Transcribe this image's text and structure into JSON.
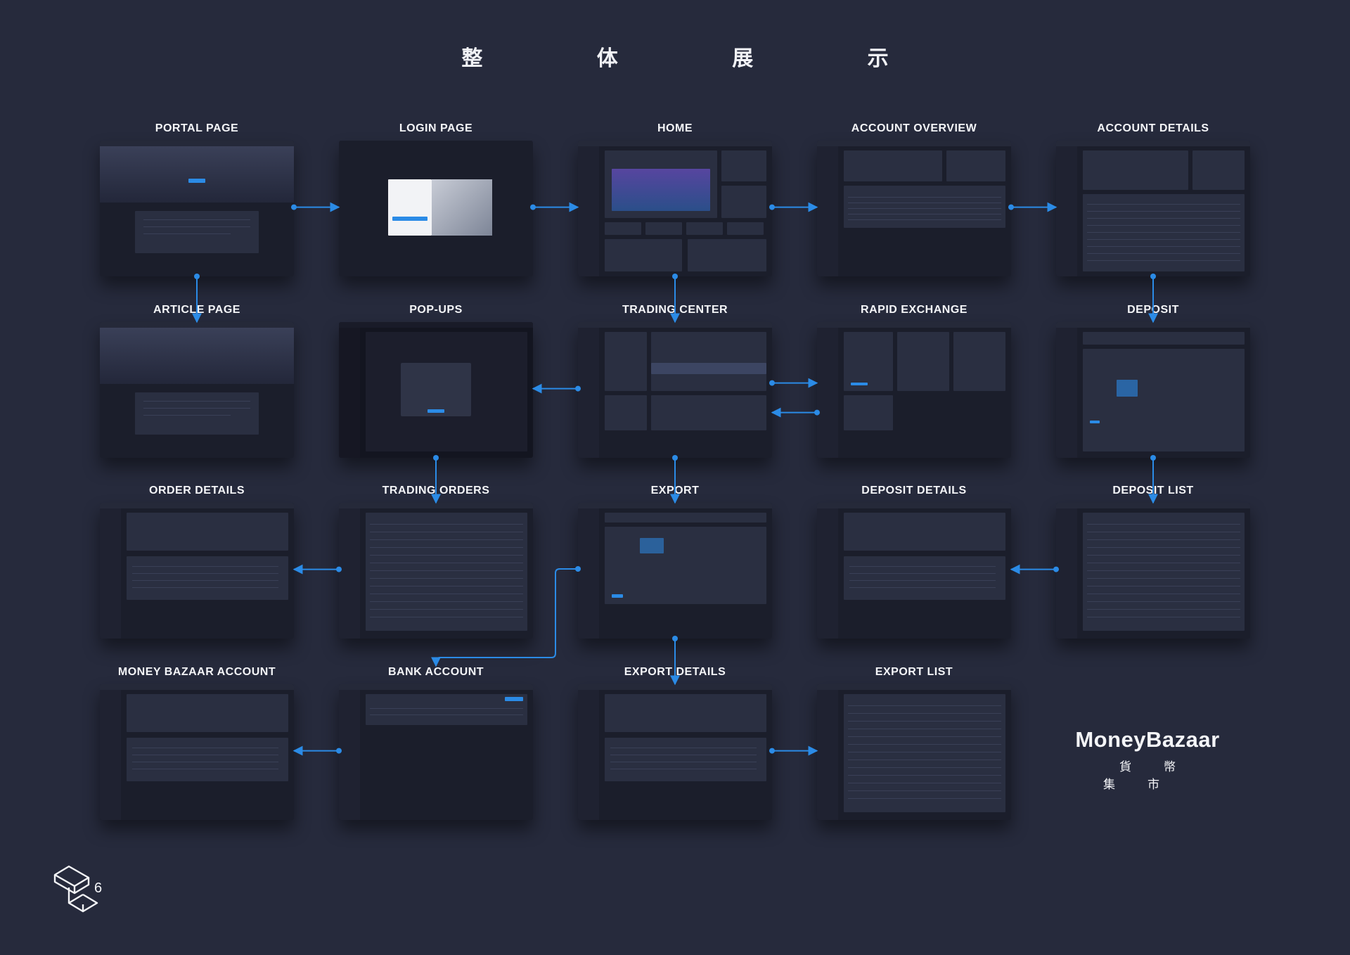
{
  "title": "整 体 展 示",
  "screens": [
    {
      "id": "portal-page",
      "label": "PORTAL PAGE",
      "kind": "portal"
    },
    {
      "id": "login-page",
      "label": "LOGIN PAGE",
      "kind": "login"
    },
    {
      "id": "home",
      "label": "HOME",
      "kind": "home"
    },
    {
      "id": "account-overview",
      "label": "ACCOUNT OVERVIEW",
      "kind": "overview"
    },
    {
      "id": "account-details",
      "label": "ACCOUNT DETAILS",
      "kind": "details"
    },
    {
      "id": "article-page",
      "label": "ARTICLE PAGE",
      "kind": "article"
    },
    {
      "id": "pop-ups",
      "label": "POP-UPS",
      "kind": "popup"
    },
    {
      "id": "trading-center",
      "label": "TRADING CENTER",
      "kind": "trading"
    },
    {
      "id": "rapid-exchange",
      "label": "RAPID EXCHANGE",
      "kind": "exchange"
    },
    {
      "id": "deposit",
      "label": "DEPOSIT",
      "kind": "deposit"
    },
    {
      "id": "order-details",
      "label": "ORDER DETAILS",
      "kind": "split"
    },
    {
      "id": "trading-orders",
      "label": "TRADING ORDERS",
      "kind": "table"
    },
    {
      "id": "export",
      "label": "EXPORT",
      "kind": "form"
    },
    {
      "id": "deposit-details",
      "label": "DEPOSIT DETAILS",
      "kind": "split"
    },
    {
      "id": "deposit-list",
      "label": "DEPOSIT LIST",
      "kind": "table"
    },
    {
      "id": "money-bazaar-account",
      "label": "MONEY BAZAAR ACCOUNT",
      "kind": "split"
    },
    {
      "id": "bank-account",
      "label": "BANK ACCOUNT",
      "kind": "bank"
    },
    {
      "id": "export-details",
      "label": "EXPORT DETAILS",
      "kind": "split"
    },
    {
      "id": "export-list",
      "label": "EXPORT LIST",
      "kind": "table"
    }
  ],
  "connections": [
    [
      "portal-page",
      "login-page"
    ],
    [
      "login-page",
      "home"
    ],
    [
      "home",
      "account-overview"
    ],
    [
      "account-overview",
      "account-details"
    ],
    [
      "portal-page",
      "article-page"
    ],
    [
      "home",
      "trading-center"
    ],
    [
      "account-details",
      "deposit"
    ],
    [
      "trading-center",
      "pop-ups"
    ],
    [
      "trading-center",
      "rapid-exchange"
    ],
    [
      "rapid-exchange",
      "trading-center"
    ],
    [
      "pop-ups",
      "trading-orders"
    ],
    [
      "trading-center",
      "export"
    ],
    [
      "deposit",
      "deposit-list"
    ],
    [
      "trading-orders",
      "order-details"
    ],
    [
      "deposit-list",
      "deposit-details"
    ],
    [
      "export",
      "bank-account"
    ],
    [
      "export",
      "export-details"
    ],
    [
      "bank-account",
      "money-bazaar-account"
    ],
    [
      "export-details",
      "export-list"
    ]
  ],
  "brand": {
    "name": "MoneyBazaar",
    "tagline": "貨幣集市"
  },
  "corner_number": "6",
  "colors": {
    "background": "#262a3c",
    "accent": "#2b8be6",
    "screen": "#1b1e2b"
  }
}
